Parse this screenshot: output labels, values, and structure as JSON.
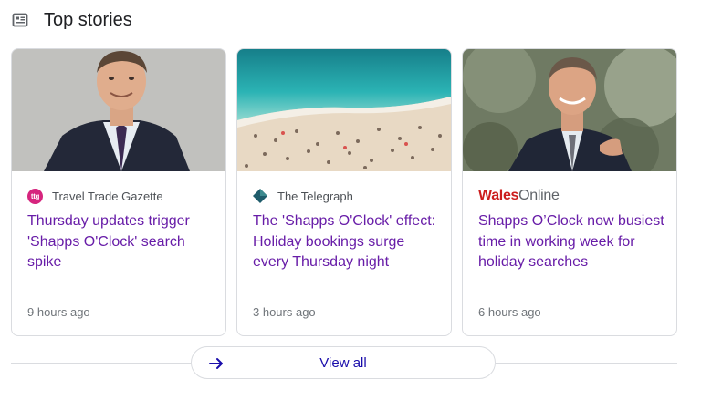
{
  "header": {
    "title": "Top stories",
    "icon": "news-icon"
  },
  "stories": [
    {
      "source": "Travel Trade Gazette",
      "logo_text": "ttg",
      "headline": "Thursday updates trigger 'Shapps O'Clock' search spike",
      "time": "9 hours ago"
    },
    {
      "source": "The Telegraph",
      "headline": "The 'Shapps O'Clock' effect: Holiday bookings surge every Thursday night",
      "time": "3 hours ago"
    },
    {
      "source_part1": "Wales",
      "source_part2": "Online",
      "headline": "Shapps O’Clock now busiest time in working week for holiday searches",
      "time": "6 hours ago"
    }
  ],
  "footer": {
    "view_all_label": "View all",
    "icon": "arrow-right-icon"
  },
  "colors": {
    "headline": "#681da8",
    "link": "#1a0dab",
    "ttg": "#d6257e",
    "wales": "#cc1d1d"
  }
}
